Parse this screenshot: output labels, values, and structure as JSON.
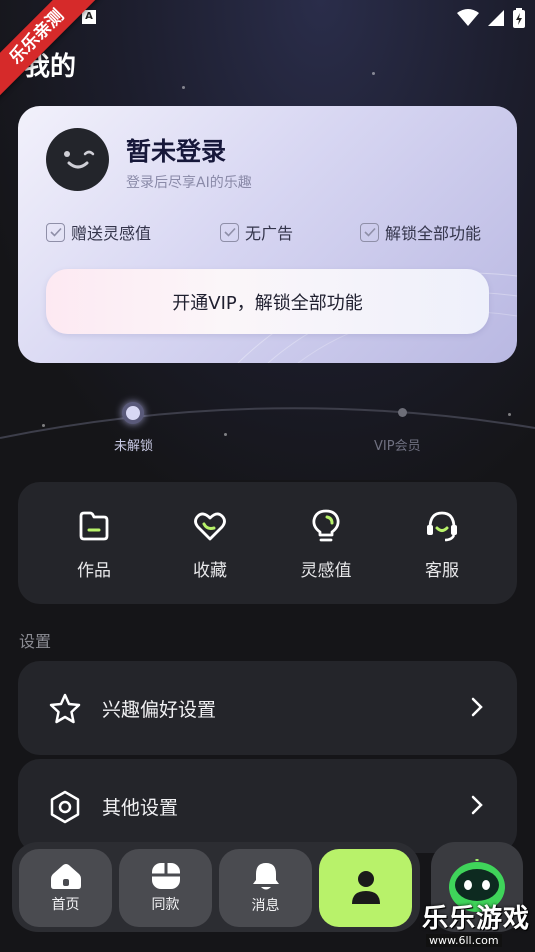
{
  "status_bar": {
    "indicator": "A"
  },
  "watermark": {
    "ribbon": "乐乐亲测",
    "brand_title": "乐乐游戏",
    "brand_url": "www.6ll.com"
  },
  "page": {
    "title": "我的"
  },
  "login_card": {
    "title": "暂未登录",
    "subtitle": "登录后尽享AI的乐趣",
    "benefits": [
      "赠送灵感值",
      "无广告",
      "解锁全部功能"
    ],
    "vip_button": "开通VIP，解锁全部功能"
  },
  "level_track": {
    "current": "未解锁",
    "next": "VIP会员"
  },
  "quick_actions": [
    {
      "label": "作品",
      "icon": "works-icon"
    },
    {
      "label": "收藏",
      "icon": "heart-icon"
    },
    {
      "label": "灵感值",
      "icon": "lightbulb-icon"
    },
    {
      "label": "客服",
      "icon": "headset-icon"
    }
  ],
  "settings": {
    "section_label": "设置",
    "rows": [
      {
        "label": "兴趣偏好设置",
        "icon": "star-icon"
      },
      {
        "label": "其他设置",
        "icon": "hexagon-settings-icon"
      }
    ]
  },
  "bottom_nav": [
    {
      "label": "首页",
      "icon": "home-icon"
    },
    {
      "label": "同款",
      "icon": "mouse-icon"
    },
    {
      "label": "消息",
      "icon": "bell-icon"
    },
    {
      "label": "",
      "icon": "person-icon",
      "active": true
    }
  ],
  "colors": {
    "accent": "#b8f26a",
    "card": "#24252a",
    "background": "#151518"
  }
}
